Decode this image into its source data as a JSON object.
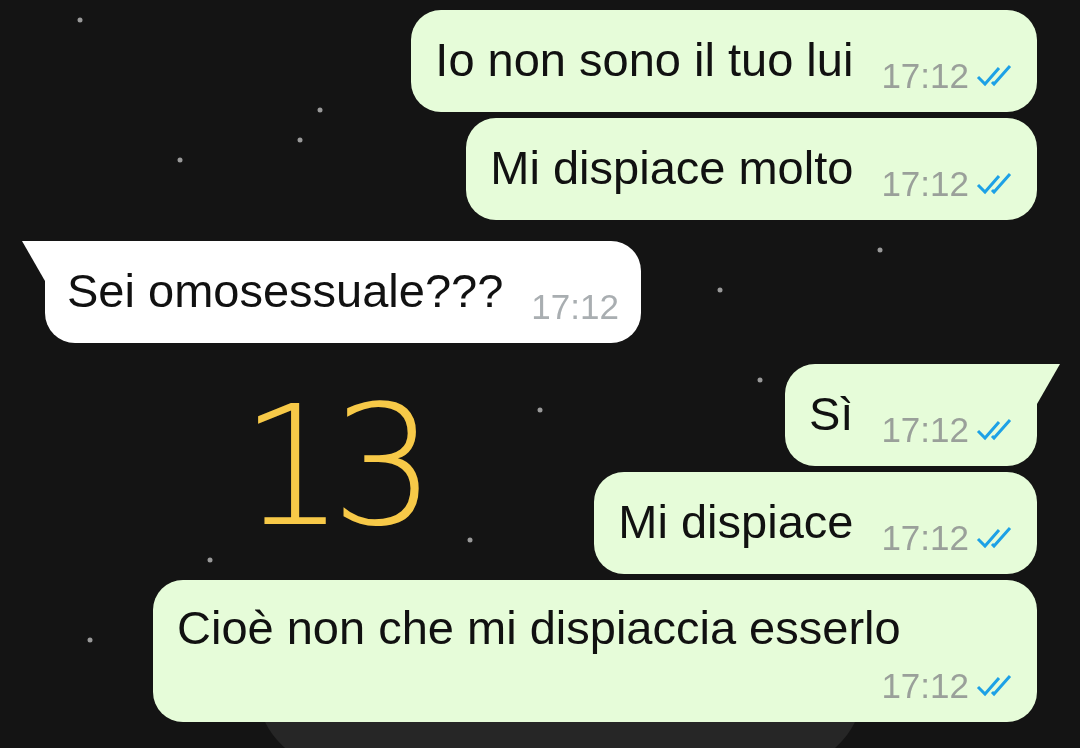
{
  "messages": [
    {
      "outgoing": true,
      "tail": false,
      "text": "Io non sono il tuo lui",
      "time": "17:12",
      "read": true
    },
    {
      "outgoing": true,
      "tail": false,
      "text": "Mi dispiace molto",
      "time": "17:12",
      "read": true
    },
    {
      "outgoing": false,
      "tail": true,
      "text": "Sei omosessuale???",
      "time": "17:12"
    },
    {
      "outgoing": true,
      "tail": true,
      "text": "Sì",
      "time": "17:12",
      "read": true
    },
    {
      "outgoing": true,
      "tail": false,
      "text": "Mi dispiace",
      "time": "17:12",
      "read": true
    },
    {
      "outgoing": true,
      "tail": false,
      "text": "Cioè non che mi dispiaccia esserlo",
      "time": "17:12",
      "read": true
    }
  ],
  "annotation": "13"
}
